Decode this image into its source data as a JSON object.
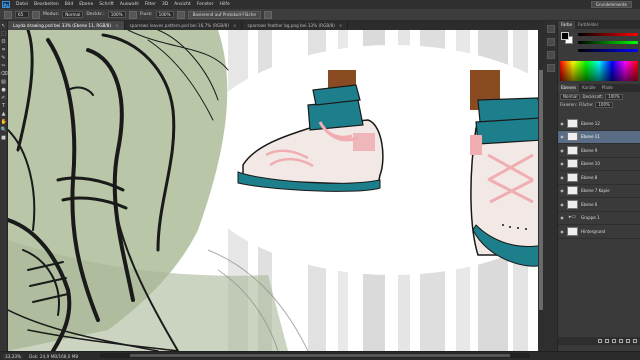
{
  "app": {
    "logo": "Ps",
    "workspace": "Grundelemente"
  },
  "menu": [
    "Datei",
    "Bearbeiten",
    "Bild",
    "Ebene",
    "Schrift",
    "Auswahl",
    "Filter",
    "3D",
    "Ansicht",
    "Fenster",
    "Hilfe"
  ],
  "options": {
    "mode_label": "Modus:",
    "mode_value": "Normal",
    "opacity_label": "Deckkr.:",
    "opacity_value": "100%",
    "flow_label": "Fluss:",
    "flow_value": "100%",
    "brush_size": "65",
    "brush_panel_button": "Basierend auf Protokoll-Fläche"
  },
  "tabs": [
    {
      "label": "Layda drawing.psd bei 33% (Ebene 11, RGB/8)",
      "active": true
    },
    {
      "label": "sparrows leaves pattern.psd bei 16,7% (RGB/8)",
      "active": false
    },
    {
      "label": "sparrows feather bg.png bei 33% (RGB/8)",
      "active": false
    }
  ],
  "tools": [
    "↖",
    "⬚",
    "ʘ",
    "⌗",
    "✎",
    "✂",
    "⌫",
    "▧",
    "●",
    "✍",
    "T",
    "▲",
    "✋",
    "🔍",
    "■"
  ],
  "status": {
    "zoom": "33,33%",
    "doc": "Dok: 24,9 MB/168,0 MB"
  },
  "panels": {
    "color_tabs": [
      "Farbe",
      "Farbfelder"
    ],
    "layers_tabs": [
      "Ebenen",
      "Kanäle",
      "Pfade"
    ],
    "blend_mode": "Normal",
    "opacity_label": "Deckkraft:",
    "opacity_value": "100%",
    "fill_label": "Fläche:",
    "fill_value": "100%",
    "lock_label": "Fixieren:",
    "layers": [
      {
        "name": "Ebene 12",
        "active": false,
        "group": false
      },
      {
        "name": "Ebene 11",
        "active": true,
        "group": false
      },
      {
        "name": "Ebene 9",
        "active": false,
        "group": false
      },
      {
        "name": "Ebene 10",
        "active": false,
        "group": false
      },
      {
        "name": "Ebene 8",
        "active": false,
        "group": false
      },
      {
        "name": "Ebene 7 Kopie",
        "active": false,
        "group": false
      },
      {
        "name": "Ebene 6",
        "active": false,
        "group": false
      },
      {
        "name": "Gruppe 1",
        "active": false,
        "group": true
      },
      {
        "name": "Hintergrund",
        "active": false,
        "group": false
      }
    ]
  },
  "colors": {
    "sage": "#b9c6a8",
    "teal": "#1e7f8c",
    "pink": "#f0aeb2",
    "shoe_white": "#f2e9e6",
    "skin": "#8a4a22"
  }
}
